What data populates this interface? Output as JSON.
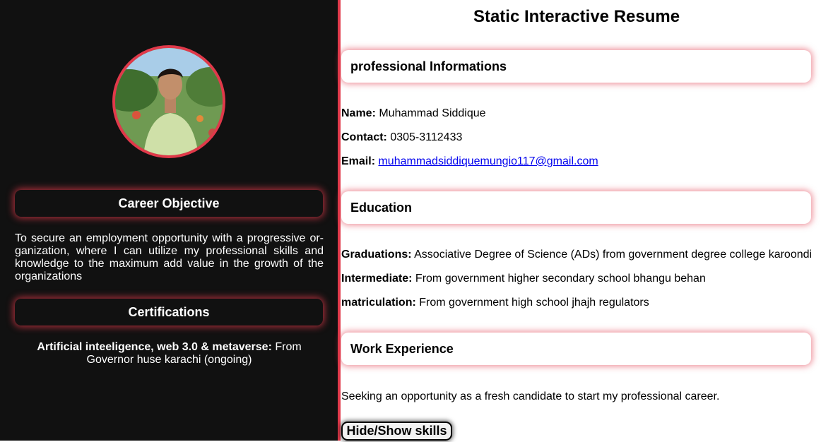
{
  "colors": {
    "accent": "#e0394a",
    "sidebar_bg": "#111111",
    "link": "#0000ee"
  },
  "sidebar": {
    "career_heading": "Career Objective",
    "career_text": "To secure an employment opportunity with a progressive or-ganization, where I can utilize my professional skills and knowledge to the maximum add value in the growth of the organizations",
    "cert_heading": "Certifications",
    "cert_label": "Artificial inteeligence, web 3.0 & metaverse:",
    "cert_value": " From Governor huse karachi (ongoing)"
  },
  "main": {
    "title": "Static Interactive Resume",
    "professional": {
      "heading": "professional Informations",
      "name_label": "Name:",
      "name_value": " Muhammad Siddique",
      "contact_label": "Contact:",
      "contact_value": " 0305-3112433",
      "email_label": "Email:",
      "email_value": "muhammadsiddiquemungio117@gmail.com"
    },
    "education": {
      "heading": "Education",
      "grad_label": "Graduations:",
      "grad_value": " Associative Degree of Science (ADs) from government degree college karoondi",
      "inter_label": "Intermediate:",
      "inter_value": " From government higher secondary school bhangu behan",
      "matric_label": "matriculation:",
      "matric_value": " From government high school jhajh regulators"
    },
    "work": {
      "heading": "Work Experience",
      "text": "Seeking an opportunity as a fresh candidate to start my professional career."
    },
    "toggle_label": "Hide/Show skills"
  }
}
